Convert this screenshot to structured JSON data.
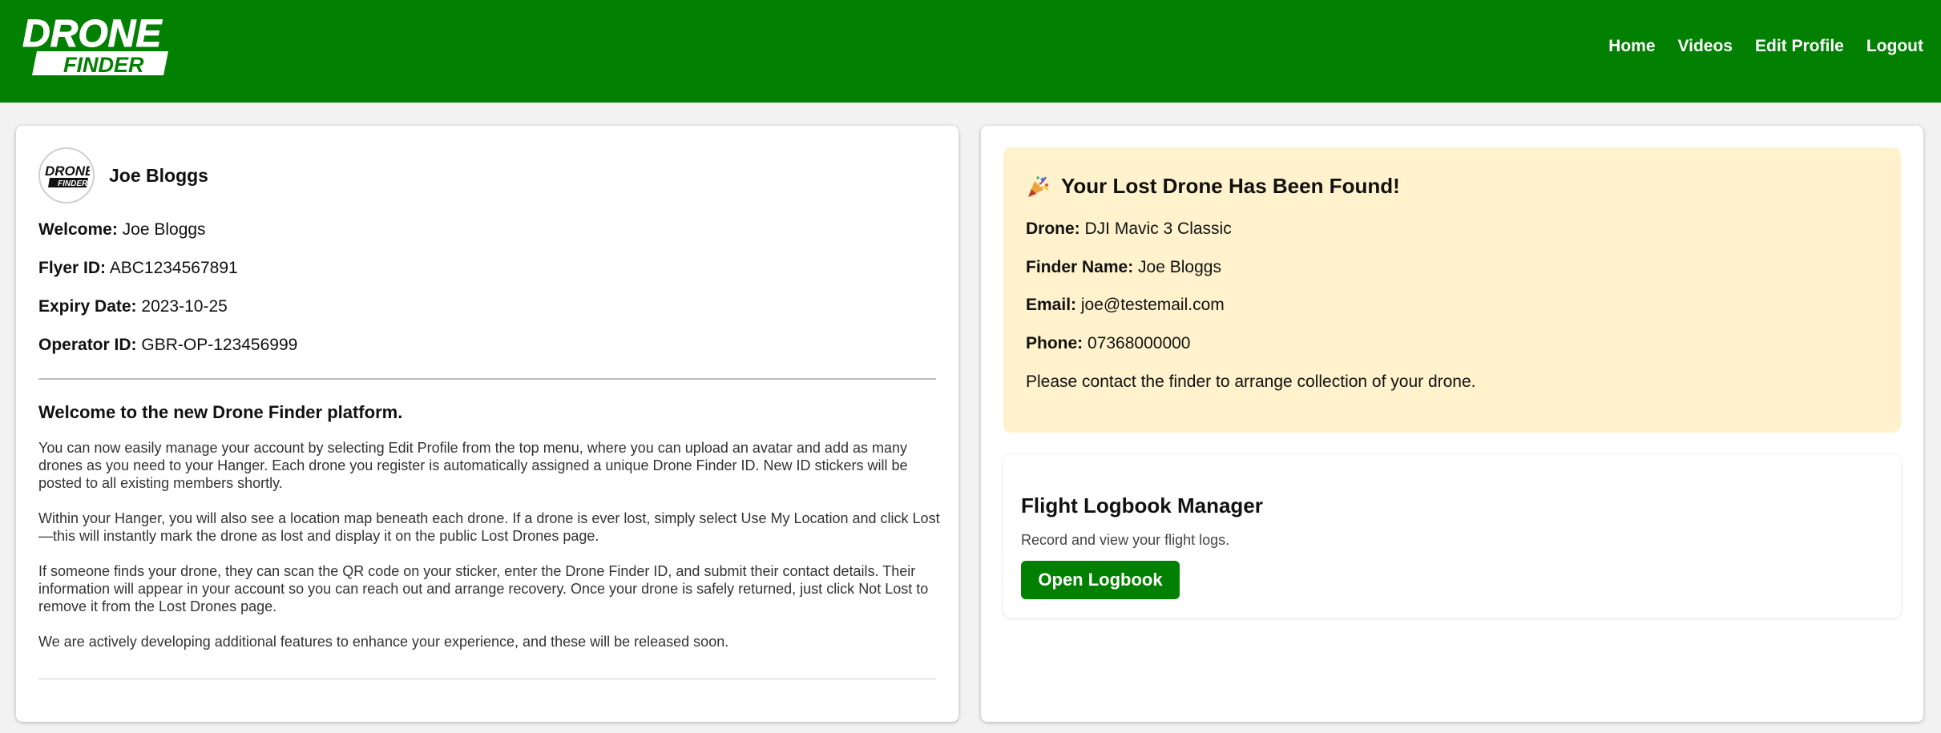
{
  "header": {
    "logo_top": "DRONE",
    "logo_bottom": "FINDER",
    "nav": [
      "Home",
      "Videos",
      "Edit Profile",
      "Logout"
    ]
  },
  "profile": {
    "name": "Joe Bloggs",
    "avatar_top": "DRONE",
    "avatar_bottom": "FINDER",
    "welcome_label": "Welcome:",
    "welcome_value": "Joe Bloggs",
    "flyer_label": "Flyer ID:",
    "flyer_value": "ABC1234567891",
    "expiry_label": "Expiry Date:",
    "expiry_value": "2023-10-25",
    "operator_label": "Operator ID:",
    "operator_value": "GBR-OP-123456999"
  },
  "welcome": {
    "title": "Welcome to the new Drone Finder platform.",
    "paragraphs": [
      "You can now easily manage your account by selecting Edit Profile from the top menu, where you can upload an avatar and add as many drones as you need to your Hanger. Each drone you register is automatically assigned a unique Drone Finder ID. New ID stickers will be posted to all existing members shortly.",
      "Within your Hanger, you will also see a location map beneath each drone. If a drone is ever lost, simply select Use My Location and click Lost—this will instantly mark the drone as lost and display it on the public Lost Drones page.",
      "If someone finds your drone, they can scan the QR code on your sticker, enter the Drone Finder ID, and submit their contact details. Their information will appear in your account so you can reach out and arrange recovery. Once your drone is safely returned, just click Not Lost to remove it from the Lost Drones page.",
      "We are actively developing additional features to enhance your experience, and these will be released soon."
    ]
  },
  "found": {
    "icon": "party-popper-icon",
    "title": "Your Lost Drone Has Been Found!",
    "drone_label": "Drone:",
    "drone_value": "DJI Mavic 3 Classic",
    "finder_label": "Finder Name:",
    "finder_value": "Joe Bloggs",
    "email_label": "Email:",
    "email_value": "joe@testemail.com",
    "phone_label": "Phone:",
    "phone_value": "07368000000",
    "note": "Please contact the finder to arrange collection of your drone."
  },
  "logbook": {
    "title": "Flight Logbook Manager",
    "subtitle": "Record and view your flight logs.",
    "button": "Open Logbook"
  },
  "colors": {
    "brand_green": "#018001",
    "found_bg": "#fff2cc",
    "page_bg": "#f2f2f2"
  }
}
